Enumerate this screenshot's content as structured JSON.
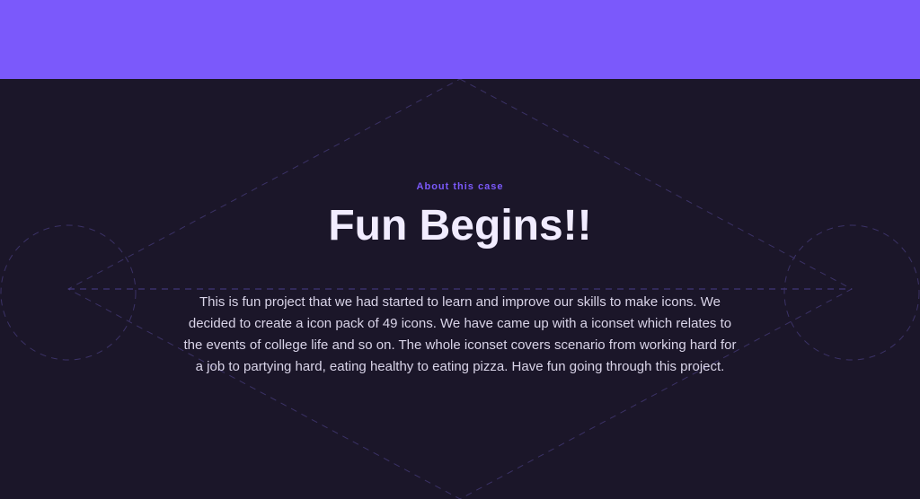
{
  "about": {
    "eyebrow": "About this case",
    "headline": "Fun Begins!!",
    "body": "This is fun project that we had started to learn and improve our skills to make icons. We decided to create a icon pack of 49 icons. We have came up with a iconset which relates to the events of college life and so on. The whole iconset covers scenario from working hard for a job to partying hard, eating healthy to eating pizza. Have fun going through this project."
  },
  "colors": {
    "accent": "#7b59fb",
    "background": "#1b1629",
    "heading": "#f1ecff",
    "text": "#d9d4e8",
    "deco_line": "#3b3266"
  }
}
